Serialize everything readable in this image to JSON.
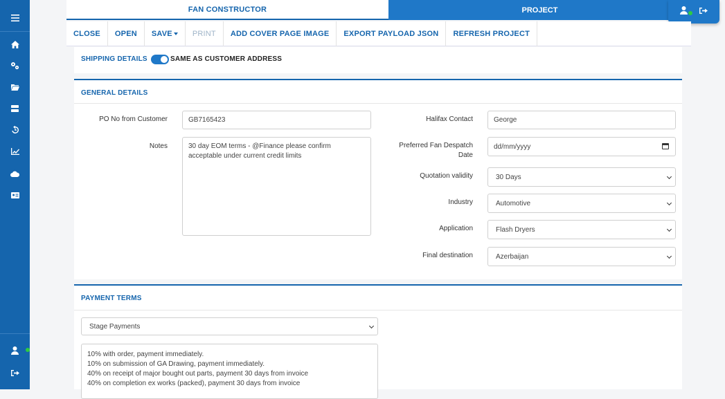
{
  "sidebar": {
    "icons": [
      "menu-icon",
      "home-icon",
      "settings-icon",
      "folder-icon",
      "server-icon",
      "history-icon",
      "chart-icon",
      "cloud-icon",
      "id-card-icon",
      "user-icon",
      "logout-icon"
    ]
  },
  "tabs": {
    "fan_constructor": "FAN CONSTRUCTOR",
    "project": "PROJECT"
  },
  "toolbar": {
    "close": "CLOSE",
    "open": "OPEN",
    "save": "SAVE",
    "print": "PRINT",
    "cover": "ADD COVER PAGE IMAGE",
    "export": "EXPORT PAYLOAD JSON",
    "refresh": "REFRESH PROJECT"
  },
  "shipping": {
    "title": "SHIPPING DETAILS",
    "toggle_label": "SAME AS CUSTOMER ADDRESS",
    "toggle_on": true
  },
  "general": {
    "title": "GENERAL DETAILS",
    "po_label": "PO No from Customer",
    "po_value": "GB7165423",
    "notes_label": "Notes",
    "notes_value": "30 day EOM terms - @Finance please confirm acceptable under current credit limits",
    "contact_label": "Halifax Contact",
    "contact_value": "George",
    "despatch_label_1": "Preferred Fan Despatch",
    "despatch_label_2": "Date",
    "despatch_value": "dd/mm/yyyy",
    "validity_label": "Quotation validity",
    "validity_value": "30 Days",
    "industry_label": "Industry",
    "industry_value": "Automotive",
    "application_label": "Application",
    "application_value": "Flash Dryers",
    "destination_label": "Final destination",
    "destination_value": "Azerbaijan"
  },
  "payment": {
    "title": "PAYMENT TERMS",
    "type_value": "Stage Payments",
    "lines": [
      "10% with order, payment immediately.",
      "10% on submission of GA Drawing, payment immediately.",
      "40% on receipt of major bought out parts, payment 30 days from invoice",
      "40% on completion ex works (packed), payment 30 days from invoice"
    ]
  },
  "colors": {
    "primary": "#1565ad",
    "tab_active": "#1f78c8",
    "status_online": "#2ecc40"
  }
}
